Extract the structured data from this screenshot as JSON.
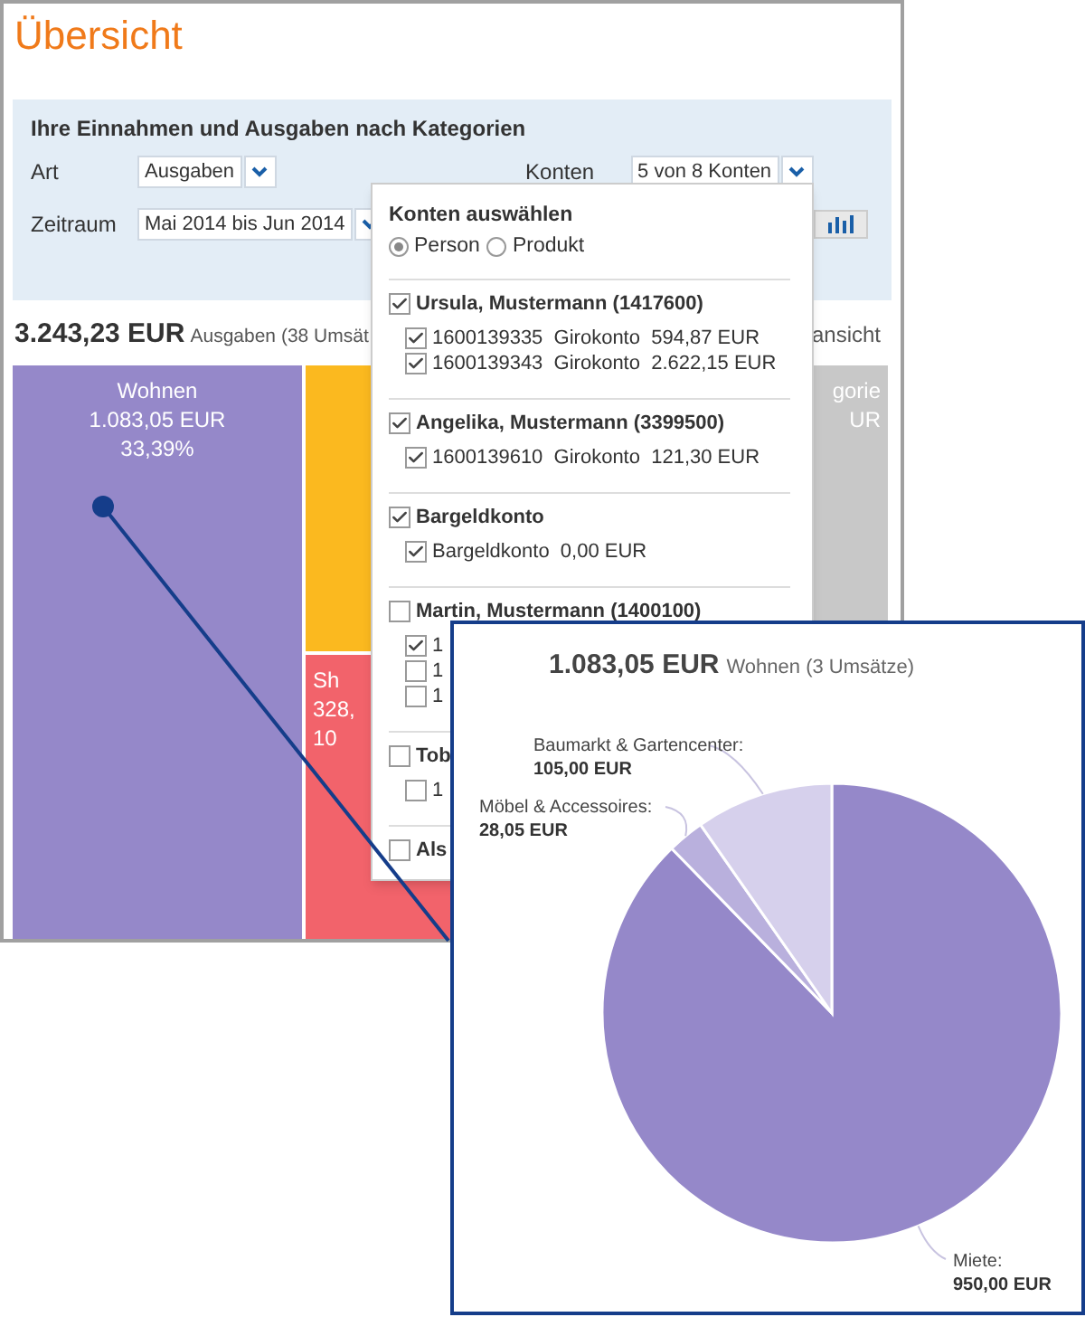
{
  "title": "Übersicht",
  "filter": {
    "heading": "Ihre Einnahmen und Ausgaben nach Kategorien",
    "fields": [
      {
        "label": "Art",
        "value": "Ausgaben"
      },
      {
        "label": "Konten",
        "value": "5 von 8 Konten"
      },
      {
        "label": "Zeitraum",
        "value": "Mai 2014 bis Jun 2014"
      }
    ]
  },
  "summary": {
    "amount": "3.243,23 EUR",
    "text": "Ausgaben (38 Umsät",
    "right_text": "ansicht"
  },
  "treemap": {
    "tiles": [
      {
        "kind": "full",
        "lines": [
          "Wohnen",
          "1.083,05 EUR",
          "33,39%"
        ],
        "color": "#9588c9"
      },
      {
        "kind": "full",
        "color": "#fbb91f"
      },
      {
        "kind": "right_covered",
        "lines": [
          "Sh",
          "328,",
          "10"
        ],
        "color": "#f2636b"
      },
      {
        "kind": "left_covered",
        "lines": [
          "gorie",
          "UR"
        ],
        "color": "#c8c8c8"
      }
    ]
  },
  "accounts_dropdown": {
    "title": "Konten auswählen",
    "options": [
      {
        "label": "Person",
        "selected": true
      },
      {
        "label": "Produkt",
        "selected": false
      }
    ],
    "groups": [
      {
        "label": "Ursula, Mustermann (1417600)",
        "checked": true,
        "accounts": [
          {
            "text": "1600139335  Girokonto  594,87 EUR",
            "checked": true
          },
          {
            "text": "1600139343  Girokonto  2.622,15 EUR",
            "checked": true
          }
        ]
      },
      {
        "label": "Angelika, Mustermann (3399500)",
        "checked": true,
        "accounts": [
          {
            "text": "1600139610  Girokonto  121,30 EUR",
            "checked": true
          }
        ]
      },
      {
        "label": "Bargeldkonto",
        "checked": true,
        "accounts": [
          {
            "text": "Bargeldkonto  0,00 EUR",
            "checked": true
          }
        ]
      },
      {
        "label": "Martin, Mustermann (1400100)",
        "checked": false,
        "accounts": [
          {
            "text": "1",
            "checked": true
          },
          {
            "text": "1",
            "checked": false
          },
          {
            "text": "1",
            "checked": false
          }
        ]
      },
      {
        "label": "Tob",
        "checked": false,
        "accounts": [
          {
            "text": "1",
            "checked": false
          }
        ]
      },
      {
        "label": "Als",
        "checked": false
      }
    ]
  },
  "detail": {
    "amount": "1.083,05 EUR",
    "text": "Wohnen (3 Umsätze)",
    "label_separator": ":",
    "chart_data": {
      "type": "pie",
      "categories": [
        "Miete",
        "Möbel & Accessoires",
        "Baumarkt & Gartencenter"
      ],
      "values": [
        950,
        28.05,
        105
      ],
      "colors": [
        "#9588c9",
        "#b9b0dd",
        "#d6d0ec"
      ],
      "value_labels": [
        "950,00 EUR",
        "28,05 EUR",
        "105,00 EUR"
      ]
    }
  }
}
